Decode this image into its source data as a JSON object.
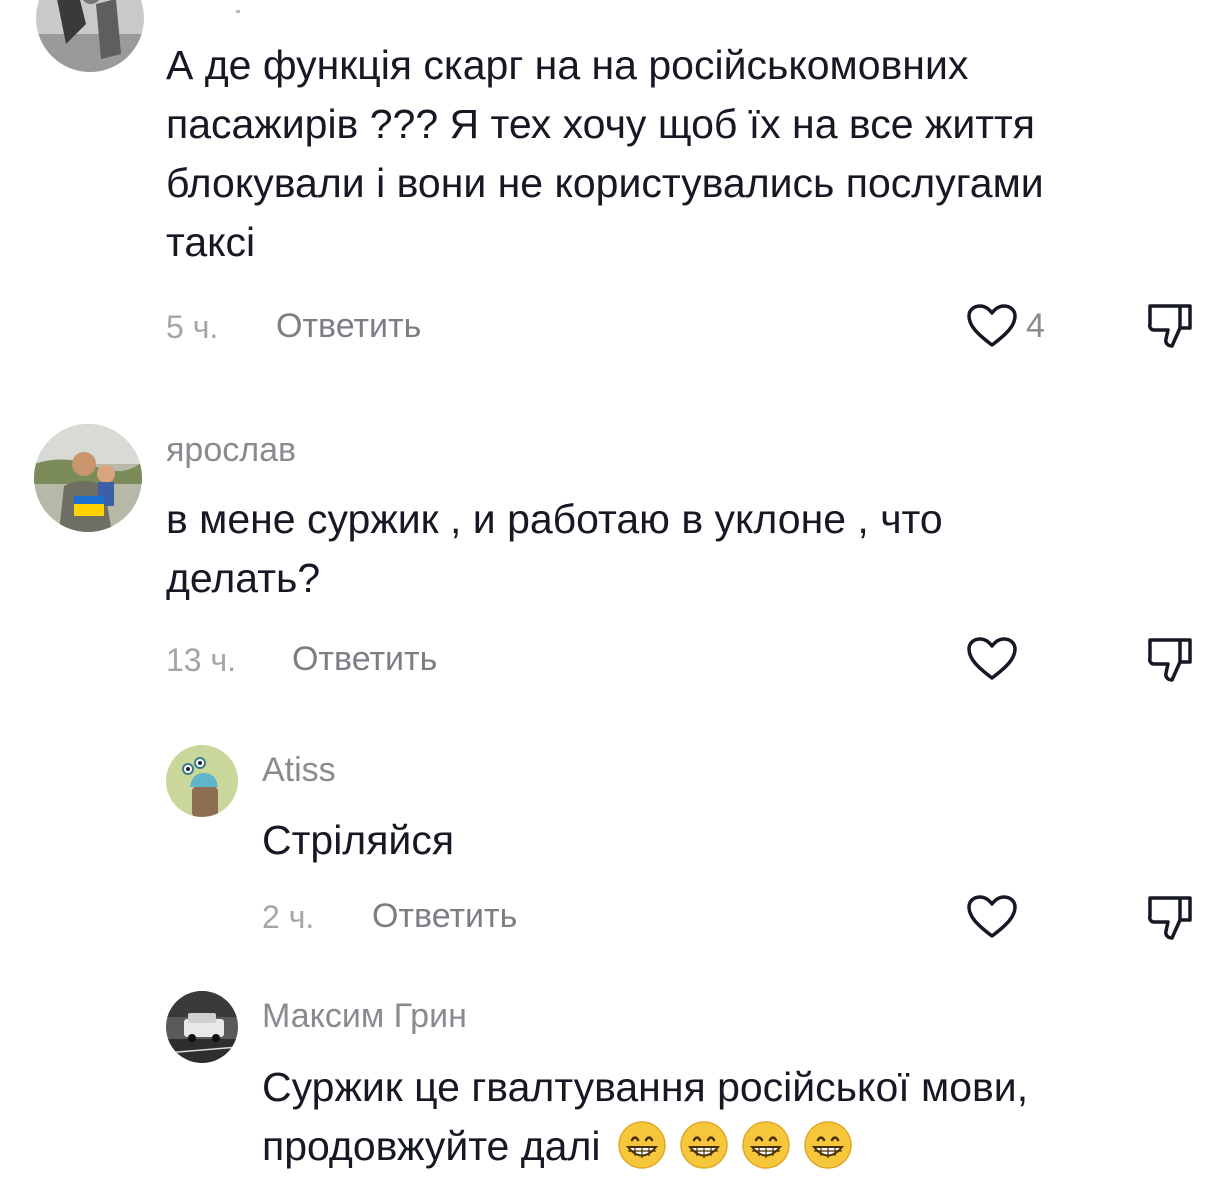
{
  "comments": [
    {
      "username": "",
      "lines": [
        "А де функція скарг на на російськомовних",
        "пасажирів ??? Я тех хочу щоб їх на все життя",
        "блокували і вони не користувались послугами",
        "таксі"
      ],
      "time": "5 ч.",
      "reply_label": "Ответить",
      "likes": "4"
    },
    {
      "username": "ярослав",
      "lines": [
        "в мене суржик , и работаю в уклоне , что",
        "делать?"
      ],
      "time": "13 ч.",
      "reply_label": "Ответить",
      "likes": ""
    },
    {
      "username": "Atiss",
      "lines": [
        "Стріляйся"
      ],
      "time": "2 ч.",
      "reply_label": "Ответить",
      "likes": ""
    },
    {
      "username": "Максим Грин",
      "lines": [
        "Суржик це гвалтування російської мови,",
        "продовжуйте далі"
      ],
      "time": "",
      "reply_label": "",
      "likes": ""
    }
  ],
  "icons": {
    "like": "heart-outline-icon",
    "dislike": "thumbs-down-icon",
    "emoji": "grinning-face-emoji"
  },
  "colors": {
    "text": "#161823",
    "username": "#8a8b91",
    "meta": "#a4a5aa",
    "emoji_yellow": "#f7c73b"
  }
}
